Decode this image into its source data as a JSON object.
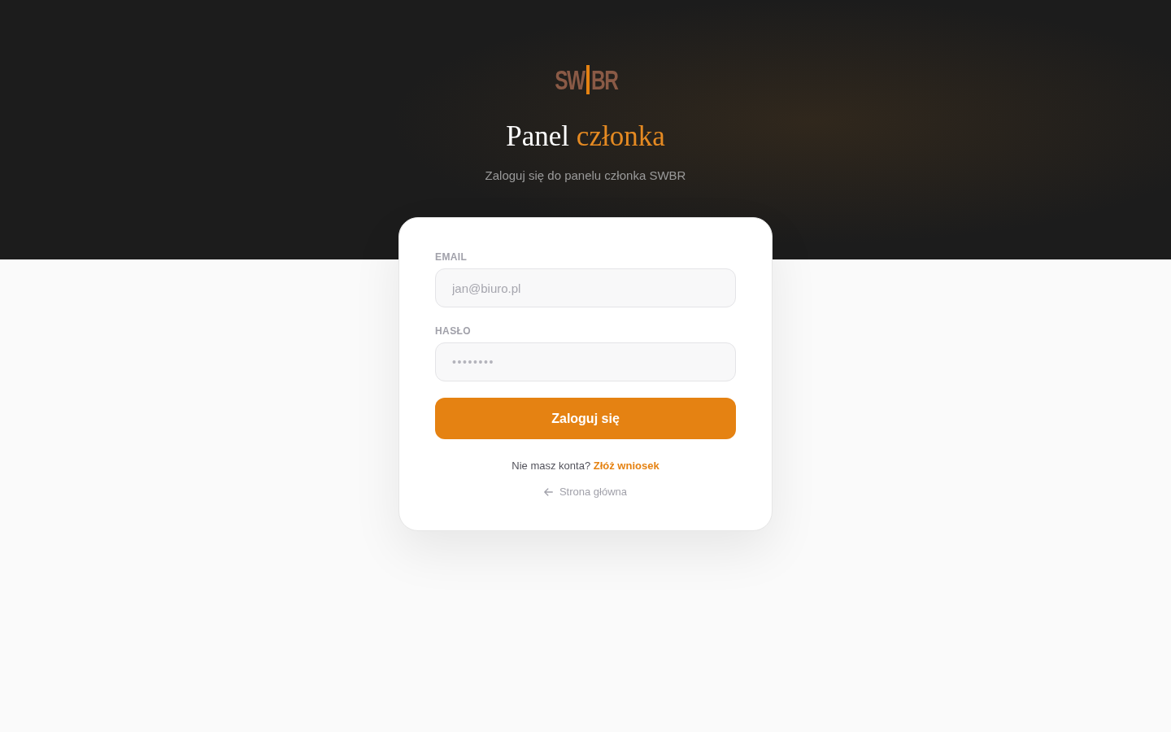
{
  "header": {
    "logo": {
      "parts": [
        "SW",
        "BR"
      ]
    },
    "title": {
      "text": "Panel",
      "accent": "członka"
    },
    "subtitle": "Zaloguj się do panelu członka SWBR"
  },
  "login_form": {
    "fields": [
      {
        "kind": "email",
        "label": "EMAIL",
        "placeholder": "jan@biuro.pl"
      },
      {
        "kind": "password",
        "label": "HASŁO",
        "placeholder": "••••••••"
      }
    ],
    "submit": "Zaloguj się",
    "signup": {
      "prompt": "Nie masz konta?",
      "link": "Złóż wniosek"
    },
    "back_link": "Strona główna"
  }
}
